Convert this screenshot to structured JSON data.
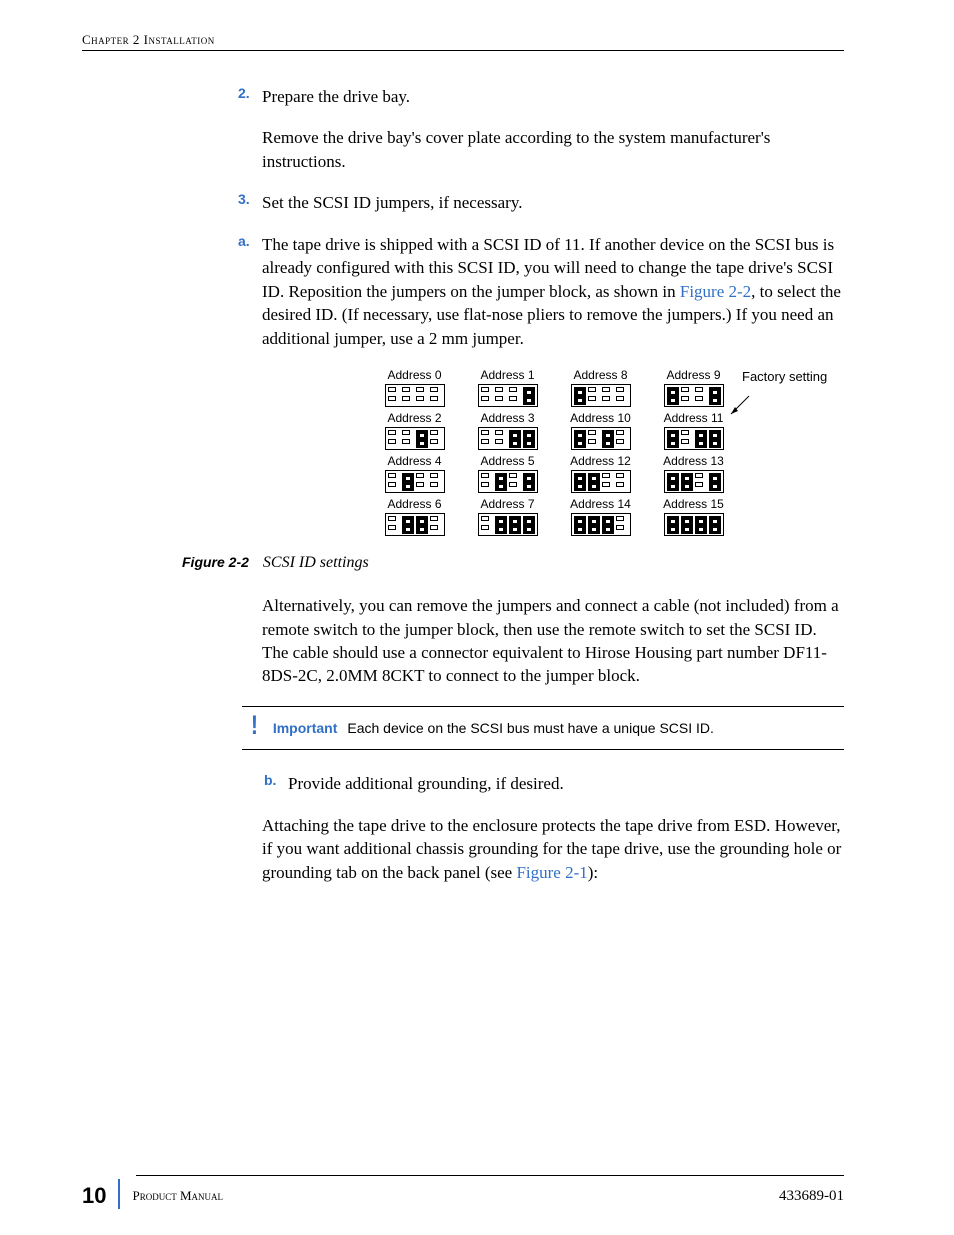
{
  "header": {
    "running": "Chapter 2  Installation"
  },
  "steps": {
    "s2": {
      "num": "2.",
      "title": "Prepare the drive bay.",
      "p1": "Remove the drive bay's cover plate according to the system manufacturer's instructions."
    },
    "s3": {
      "num": "3.",
      "title": "Set the SCSI ID jumpers, if necessary.",
      "a": {
        "num": "a.",
        "p_before": "The tape drive is shipped with a SCSI ID of 11. If another device on the SCSI bus is already configured with this SCSI ID, you will need to change the tape drive's SCSI ID. Reposition the jumpers on the jumper block, as shown in ",
        "link": "Figure 2-2",
        "p_after": ", to select the desired ID. (If necessary, use flat-nose pliers to remove the jumpers.) If you need an additional jumper, use a 2 mm jumper."
      },
      "alt": "Alternatively, you can remove the jumpers and connect a cable (not included) from a remote switch to the jumper block, then use the remote switch to set the SCSI ID. The cable should use a connector equivalent to Hirose Housing part number DF11-8DS-2C, 2.0MM 8CKT to connect to the jumper block.",
      "b": {
        "num": "b.",
        "title": "Provide additional grounding, if desired.",
        "p_before": "Attaching the tape drive to the enclosure protects the tape drive from ESD. However, if you want additional chassis grounding for the tape drive, use the grounding hole or grounding tab on the back panel (see ",
        "link": "Figure 2-1",
        "p_after": "):"
      }
    }
  },
  "figure": {
    "factory": "Factory setting",
    "caption_num": "Figure 2-2",
    "caption_text": "SCSI ID settings",
    "labels": [
      "Address 0",
      "Address 1",
      "Address 8",
      "Address 9",
      "Address 2",
      "Address 3",
      "Address 10",
      "Address 11",
      "Address 4",
      "Address 5",
      "Address 12",
      "Address 13",
      "Address 6",
      "Address 7",
      "Address 14",
      "Address 15"
    ],
    "states": [
      [
        0,
        0,
        0,
        0
      ],
      [
        0,
        0,
        0,
        1
      ],
      [
        1,
        0,
        0,
        0
      ],
      [
        1,
        0,
        0,
        1
      ],
      [
        0,
        0,
        1,
        0
      ],
      [
        0,
        0,
        1,
        1
      ],
      [
        1,
        0,
        1,
        0
      ],
      [
        1,
        0,
        1,
        1
      ],
      [
        0,
        1,
        0,
        0
      ],
      [
        0,
        1,
        0,
        1
      ],
      [
        1,
        1,
        0,
        0
      ],
      [
        1,
        1,
        0,
        1
      ],
      [
        0,
        1,
        1,
        0
      ],
      [
        0,
        1,
        1,
        1
      ],
      [
        1,
        1,
        1,
        0
      ],
      [
        1,
        1,
        1,
        1
      ]
    ]
  },
  "callout": {
    "bang": "!",
    "word": "Important",
    "msg": "Each device on the SCSI bus must have a unique SCSI ID."
  },
  "footer": {
    "page": "10",
    "left": "Product Manual",
    "right": "433689-01"
  }
}
